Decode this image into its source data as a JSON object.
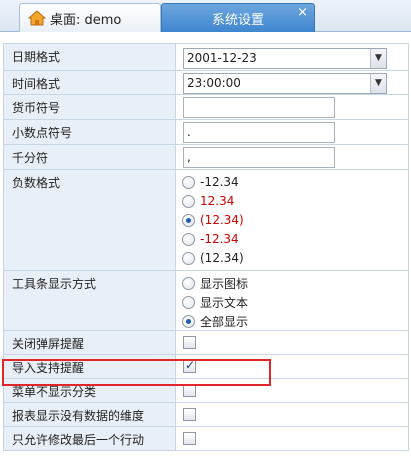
{
  "tabs": [
    {
      "label": "桌面: demo",
      "icon": "home-icon",
      "active": false
    },
    {
      "label": "系统设置",
      "active": true,
      "close": "×"
    }
  ],
  "form": {
    "date_format": {
      "label": "日期格式",
      "value": "2001-12-23"
    },
    "time_format": {
      "label": "时间格式",
      "value": "23:00:00"
    },
    "currency_symbol": {
      "label": "货币符号",
      "value": ""
    },
    "decimal_symbol": {
      "label": "小数点符号",
      "value": "."
    },
    "thousands_separator": {
      "label": "千分符",
      "value": ","
    },
    "negative_format": {
      "label": "负数格式",
      "options": [
        "-12.34",
        "12.34",
        "(12.34)",
        "-12.34",
        "(12.34)"
      ],
      "selected_index": 2
    },
    "toolbar_display": {
      "label": "工具条显示方式",
      "options": [
        "显示图标",
        "显示文本",
        "全部显示"
      ],
      "selected_index": 2
    },
    "close_popup_reminder": {
      "label": "关闭弹屏提醒",
      "checked": false
    },
    "import_support_reminder": {
      "label": "导入支持提醒",
      "checked": true
    },
    "menu_hide_category": {
      "label": "菜单不显示分类",
      "checked": false
    },
    "report_show_empty_dimensions": {
      "label": "报表显示没有数据的维度",
      "checked": false
    },
    "only_edit_last_action": {
      "label": "只允许修改最后一个行动",
      "checked": false
    }
  },
  "colors": {
    "accent": "#3f86cf",
    "label_bg": "#e9eff6",
    "negative_red": "#cc0000",
    "highlight": "#e0262b"
  }
}
